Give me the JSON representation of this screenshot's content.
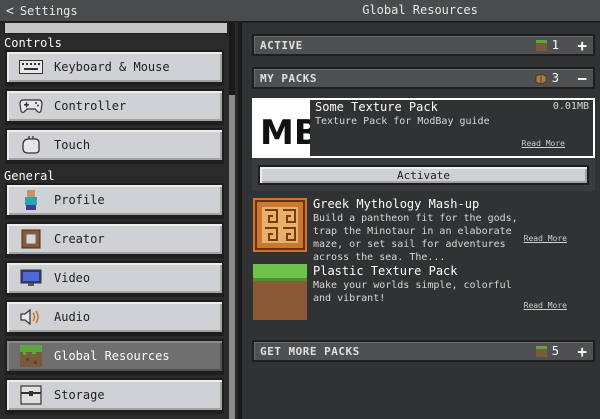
{
  "header": {
    "back_label": "Settings",
    "title": "Global Resources"
  },
  "sidebar": {
    "sections": [
      {
        "label": "Controls"
      },
      {
        "label": "General"
      }
    ],
    "items": [
      {
        "label": "Keyboard & Mouse",
        "icon": "keyboard-icon"
      },
      {
        "label": "Controller",
        "icon": "gamepad-icon"
      },
      {
        "label": "Touch",
        "icon": "touch-icon"
      },
      {
        "label": "Profile",
        "icon": "profile-icon"
      },
      {
        "label": "Creator",
        "icon": "creator-icon"
      },
      {
        "label": "Video",
        "icon": "monitor-icon"
      },
      {
        "label": "Audio",
        "icon": "speaker-icon"
      },
      {
        "label": "Global Resources",
        "icon": "grass-block-icon",
        "selected": true
      },
      {
        "label": "Storage",
        "icon": "chest-icon"
      }
    ]
  },
  "main": {
    "active": {
      "label": "ACTIVE",
      "count": "1",
      "action": "+"
    },
    "my_packs": {
      "label": "MY PACKS",
      "count": "3",
      "action": "−",
      "packs": [
        {
          "name": "Some Texture Pack",
          "description": "Texture Pack for ModBay guide",
          "size": "0.01MB",
          "read_more": "Read More",
          "thumb": "mb-logo",
          "logo_text": "MB"
        },
        {
          "name": "Greek Mythology Mash-up",
          "description": "Build a pantheon fit for the gods, trap the Minotaur in an elaborate maze, or set sail for adventures across the sea. The...",
          "read_more": "Read More",
          "thumb": "greek-pattern"
        },
        {
          "name": "Plastic Texture Pack",
          "description": "Make your worlds simple, colorful and vibrant!",
          "read_more": "Read More",
          "thumb": "grass-block"
        }
      ],
      "activate_label": "Activate"
    },
    "get_more": {
      "label": "GET MORE PACKS",
      "count": "5",
      "action": "+"
    }
  },
  "colors": {
    "background": "#313233",
    "button": "#d0d1d4",
    "selected": "#6f6f70",
    "header": "#4f5051"
  }
}
